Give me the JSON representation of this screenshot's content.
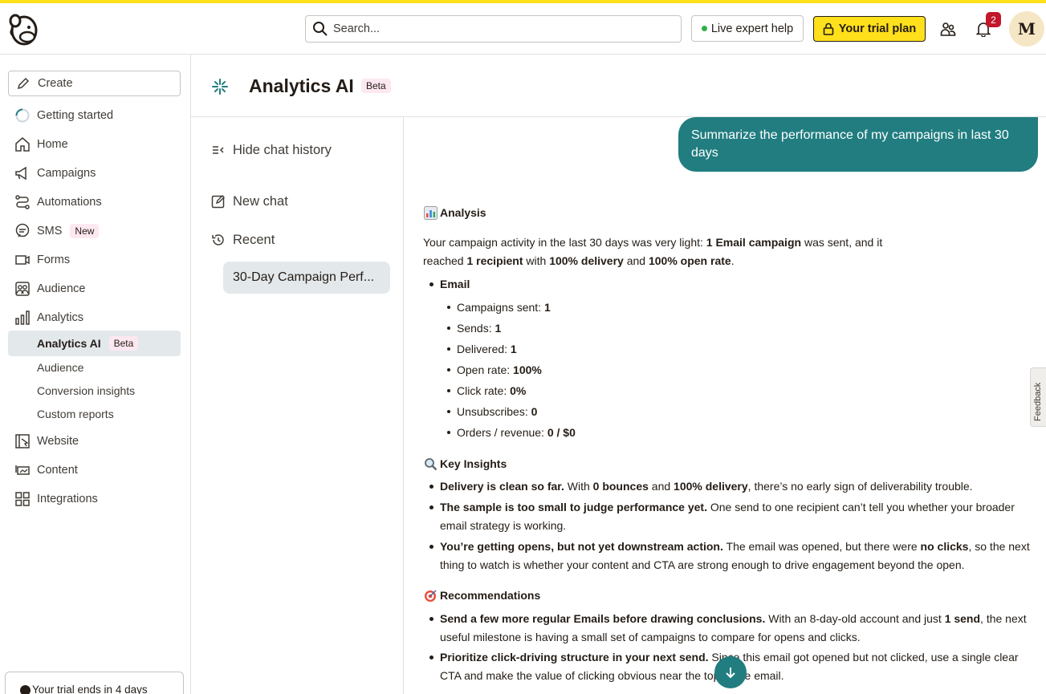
{
  "topbar": {
    "search_placeholder": "Search...",
    "expert_label": "Live expert help",
    "trial_label": "Your trial plan",
    "notification_count": "2",
    "avatar_initial": "M"
  },
  "sidebar": {
    "create_label": "Create",
    "items": [
      {
        "label": "Getting started",
        "icon": "progress-ring-icon"
      },
      {
        "label": "Home",
        "icon": "home-icon"
      },
      {
        "label": "Campaigns",
        "icon": "megaphone-icon"
      },
      {
        "label": "Automations",
        "icon": "automations-icon"
      },
      {
        "label": "SMS",
        "icon": "sms-icon",
        "badge": "New"
      },
      {
        "label": "Forms",
        "icon": "forms-icon"
      },
      {
        "label": "Audience",
        "icon": "audience-icon"
      },
      {
        "label": "Analytics",
        "icon": "analytics-icon"
      },
      {
        "label": "Website",
        "icon": "website-icon"
      },
      {
        "label": "Content",
        "icon": "content-icon"
      },
      {
        "label": "Integrations",
        "icon": "integrations-icon"
      }
    ],
    "analytics_sub": [
      {
        "label": "Analytics AI",
        "badge": "Beta",
        "active": true
      },
      {
        "label": "Audience"
      },
      {
        "label": "Conversion insights"
      },
      {
        "label": "Custom reports"
      }
    ],
    "trial_notice": "Your trial ends in 4 days"
  },
  "header": {
    "title": "Analytics AI",
    "badge": "Beta"
  },
  "chat_history": {
    "hide_label": "Hide chat history",
    "new_chat_label": "New chat",
    "recent_label": "Recent",
    "recent_items": [
      "30-Day Campaign Perf..."
    ]
  },
  "chat": {
    "user_message": "Summarize the performance of my campaigns in last 30 days",
    "analysis_heading": "Analysis",
    "analysis_para": {
      "t1": "Your campaign activity in the last 30 days was very light: ",
      "b1": "1 Email campaign",
      "t2": " was sent, and it reached ",
      "b2": "1 recipient",
      "t3": " with ",
      "b3": "100% delivery",
      "t4": " and ",
      "b4": "100% open rate",
      "t5": "."
    },
    "email_label": "Email",
    "metrics": [
      {
        "label": "Campaigns sent: ",
        "value": "1"
      },
      {
        "label": "Sends: ",
        "value": "1"
      },
      {
        "label": "Delivered: ",
        "value": "1"
      },
      {
        "label": "Open rate: ",
        "value": "100%"
      },
      {
        "label": "Click rate: ",
        "value": "0%"
      },
      {
        "label": "Unsubscribes: ",
        "value": "0"
      },
      {
        "label": "Orders / revenue: ",
        "value": "0 / $0"
      }
    ],
    "insights_heading": "Key Insights",
    "insights": {
      "i1": {
        "b": "Delivery is clean so far.",
        "t1": " With ",
        "b2": "0 bounces",
        "t2": " and ",
        "b3": "100% delivery",
        "t3": ", there’s no early sign of deliverability trouble."
      },
      "i2": {
        "b": "The sample is too small to judge performance yet.",
        "t1": " One send to one recipient can’t tell you whether your broader email strategy is working."
      },
      "i3": {
        "b": "You’re getting opens, but not yet downstream action.",
        "t1": " The email was opened, but there were ",
        "b2": "no clicks",
        "t2": ", so the next thing to watch is whether your content and CTA are strong enough to drive engagement beyond the open."
      }
    },
    "recs_heading": "Recommendations",
    "recs": {
      "r1": {
        "b": "Send a few more regular Emails before drawing conclusions.",
        "t1": " With an 8-day-old account and just ",
        "b2": "1 send",
        "t2": ", the next useful milestone is having a small set of campaigns to compare for opens and clicks."
      },
      "r2": {
        "b": "Prioritize click-driving structure in your next send.",
        "t1": " Since this email got opened but not clicked, use a single clear CTA and make the value of clicking obvious near the top of the email."
      }
    }
  },
  "feedback_label": "Feedback",
  "colors": {
    "brand_yellow": "#ffe01b",
    "teal": "#217d80",
    "badge_red": "#c3172b"
  }
}
